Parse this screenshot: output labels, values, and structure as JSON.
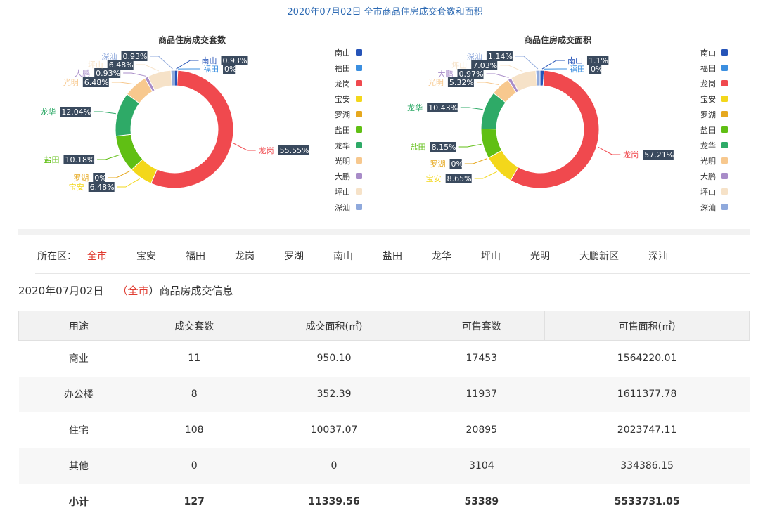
{
  "page_title": "2020年07月02日 全市商品住房成交套数和面积",
  "legend": [
    "南山",
    "福田",
    "龙岗",
    "宝安",
    "罗湖",
    "盐田",
    "龙华",
    "光明",
    "大鹏",
    "坪山",
    "深汕"
  ],
  "colors": {
    "南山": "#2654b8",
    "福田": "#3b8fe0",
    "龙岗": "#f0494e",
    "宝安": "#f3d71b",
    "罗湖": "#e6a81e",
    "盐田": "#60bf14",
    "龙华": "#2eaa67",
    "光明": "#f7c88e",
    "大鹏": "#a88cc8",
    "坪山": "#f6e2c8",
    "深汕": "#8fa9dc",
    "accent_red": "#e03c31",
    "title_blue": "#2d6ab3"
  },
  "chart_data": [
    {
      "type": "pie",
      "title": "商品住房成交套数",
      "categories": [
        "南山",
        "福田",
        "龙岗",
        "宝安",
        "罗湖",
        "盐田",
        "龙华",
        "光明",
        "大鹏",
        "坪山",
        "深汕"
      ],
      "values": [
        0.93,
        0,
        55.55,
        6.48,
        0,
        10.18,
        12.04,
        6.48,
        0.93,
        6.48,
        0.93
      ],
      "labels": [
        "0.93%",
        "0%",
        "55.55%",
        "6.48%",
        "0%",
        "10.18%",
        "12.04%",
        "6.48%",
        "0.93%",
        "6.48%",
        "0.93%"
      ],
      "legend": "right"
    },
    {
      "type": "pie",
      "title": "商品住房成交面积",
      "categories": [
        "南山",
        "福田",
        "龙岗",
        "宝安",
        "罗湖",
        "盐田",
        "龙华",
        "光明",
        "大鹏",
        "坪山",
        "深汕"
      ],
      "values": [
        1.1,
        0,
        57.21,
        8.65,
        0,
        8.15,
        10.43,
        5.32,
        0.97,
        7.03,
        1.14
      ],
      "labels": [
        "1.1%",
        "0%",
        "57.21%",
        "8.65%",
        "0%",
        "8.15%",
        "10.43%",
        "5.32%",
        "0.97%",
        "7.03%",
        "1.14%"
      ],
      "legend": "right"
    }
  ],
  "filter": {
    "label": "所在区：",
    "items": [
      "全市",
      "宝安",
      "福田",
      "龙岗",
      "罗湖",
      "南山",
      "盐田",
      "龙华",
      "坪山",
      "光明",
      "大鹏新区",
      "深汕"
    ],
    "active": "全市"
  },
  "section": {
    "date": "2020年07月02日",
    "open": "（",
    "district": "全市",
    "close": "）",
    "suffix": "商品房成交信息"
  },
  "table": {
    "headers": [
      "用途",
      "成交套数",
      "成交面积(㎡)",
      "可售套数",
      "可售面积(㎡)"
    ],
    "rows": [
      [
        "商业",
        "11",
        "950.10",
        "17453",
        "1564220.01"
      ],
      [
        "办公楼",
        "8",
        "352.39",
        "11937",
        "1611377.78"
      ],
      [
        "住宅",
        "108",
        "10037.07",
        "20895",
        "2023747.11"
      ],
      [
        "其他",
        "0",
        "0",
        "3104",
        "334386.15"
      ]
    ],
    "total": [
      "小计",
      "127",
      "11339.56",
      "53389",
      "5533731.05"
    ]
  }
}
